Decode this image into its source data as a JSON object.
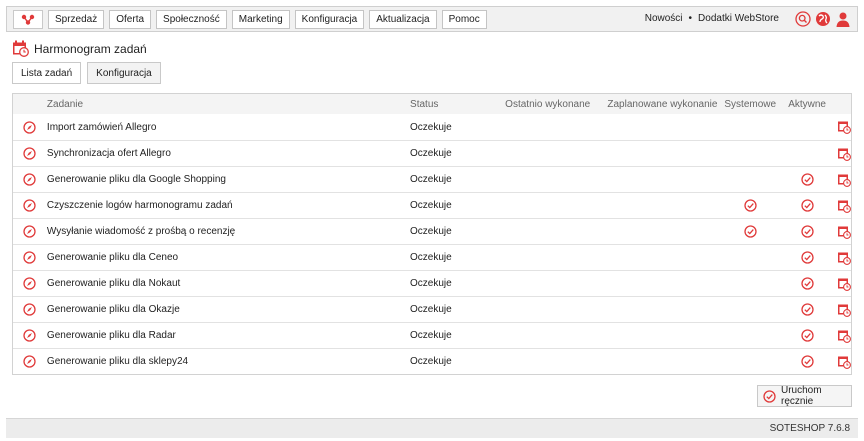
{
  "colors": {
    "accent": "#e03a3a",
    "bar_bg": "#f1f1f1",
    "header_bg": "#f4f4f4"
  },
  "nav": {
    "logo_icon": "soteshop-logo-icon",
    "items": [
      {
        "label": "Sprzedaż"
      },
      {
        "label": "Oferta"
      },
      {
        "label": "Społeczność"
      },
      {
        "label": "Marketing"
      },
      {
        "label": "Konfiguracja"
      },
      {
        "label": "Aktualizacja"
      },
      {
        "label": "Pomoc"
      }
    ],
    "news_label": "Nowości",
    "separator": "•",
    "addons_label": "Dodatki WebStore",
    "icons": [
      "search-icon",
      "globe-icon",
      "user-icon"
    ]
  },
  "page": {
    "title": "Harmonogram zadań",
    "tabs": [
      {
        "label": "Lista zadań",
        "active": true
      },
      {
        "label": "Konfiguracja",
        "active": false
      }
    ]
  },
  "table": {
    "columns": {
      "task": "Zadanie",
      "status": "Status",
      "last_run": "Ostatnio wykonane",
      "scheduled": "Zaplanowane wykonanie",
      "system": "Systemowe",
      "active": "Aktywne"
    },
    "rows": [
      {
        "name": "Import zamówień Allegro",
        "status": "Oczekuje",
        "last_run": "",
        "scheduled": "",
        "system": false,
        "active": false
      },
      {
        "name": "Synchronizacja ofert Allegro",
        "status": "Oczekuje",
        "last_run": "",
        "scheduled": "",
        "system": false,
        "active": false
      },
      {
        "name": "Generowanie pliku dla Google Shopping",
        "status": "Oczekuje",
        "last_run": "",
        "scheduled": "",
        "system": false,
        "active": true
      },
      {
        "name": "Czyszczenie logów harmonogramu zadań",
        "status": "Oczekuje",
        "last_run": "",
        "scheduled": "",
        "system": true,
        "active": true
      },
      {
        "name": "Wysyłanie wiadomość z prośbą o recenzję",
        "status": "Oczekuje",
        "last_run": "",
        "scheduled": "",
        "system": true,
        "active": true
      },
      {
        "name": "Generowanie pliku dla Ceneo",
        "status": "Oczekuje",
        "last_run": "",
        "scheduled": "",
        "system": false,
        "active": true
      },
      {
        "name": "Generowanie pliku dla Nokaut",
        "status": "Oczekuje",
        "last_run": "",
        "scheduled": "",
        "system": false,
        "active": true
      },
      {
        "name": "Generowanie pliku dla Okazje",
        "status": "Oczekuje",
        "last_run": "",
        "scheduled": "",
        "system": false,
        "active": true
      },
      {
        "name": "Generowanie pliku dla Radar",
        "status": "Oczekuje",
        "last_run": "",
        "scheduled": "",
        "system": false,
        "active": true
      },
      {
        "name": "Generowanie pliku dla sklepy24",
        "status": "Oczekuje",
        "last_run": "",
        "scheduled": "",
        "system": false,
        "active": true
      }
    ]
  },
  "actions": {
    "run_manual": "Uruchom ręcznie"
  },
  "footer": {
    "version": "SOTESHOP 7.6.8"
  }
}
